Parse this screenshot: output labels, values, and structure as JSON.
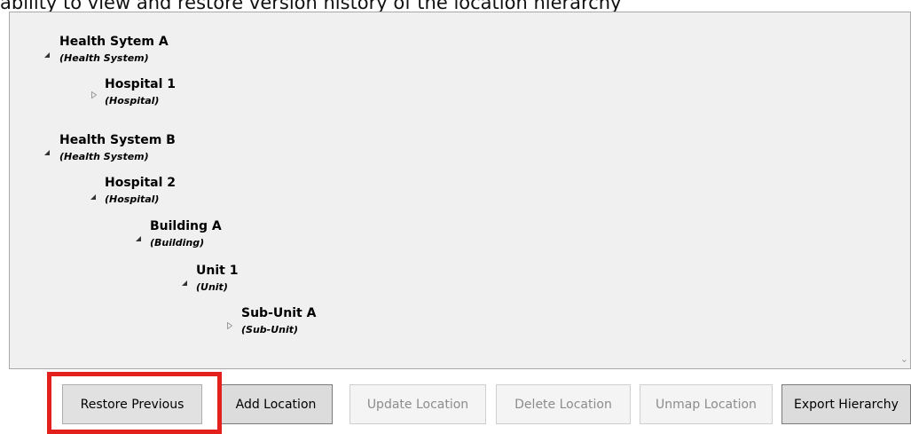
{
  "caption": "ability to view and restore version history of the location hierarchy",
  "tree": {
    "nodes": [
      {
        "name": "Health Sytem A",
        "type": "(Health System)",
        "expanded": true
      },
      {
        "name": "Hospital 1",
        "type": "(Hospital)",
        "expanded": false
      },
      {
        "name": "Health System B",
        "type": "(Health System)",
        "expanded": true
      },
      {
        "name": "Hospital 2",
        "type": "(Hospital)",
        "expanded": true
      },
      {
        "name": "Building A",
        "type": "(Building)",
        "expanded": true
      },
      {
        "name": "Unit 1",
        "type": "(Unit)",
        "expanded": true
      },
      {
        "name": "Sub-Unit A",
        "type": "(Sub-Unit)",
        "expanded": false
      }
    ]
  },
  "buttons": {
    "restore_previous": "Restore Previous",
    "add_location": "Add Location",
    "update_location": "Update Location",
    "delete_location": "Delete Location",
    "unmap_location": "Unmap Location",
    "export_hierarchy": "Export Hierarchy"
  },
  "icons": {
    "expanded": "triangle-expanded-icon",
    "collapsed": "triangle-collapsed-icon",
    "scroll_down": "chevron-down-icon"
  },
  "colors": {
    "highlight": "#e3201b",
    "panel_background": "#f0f0f0"
  }
}
